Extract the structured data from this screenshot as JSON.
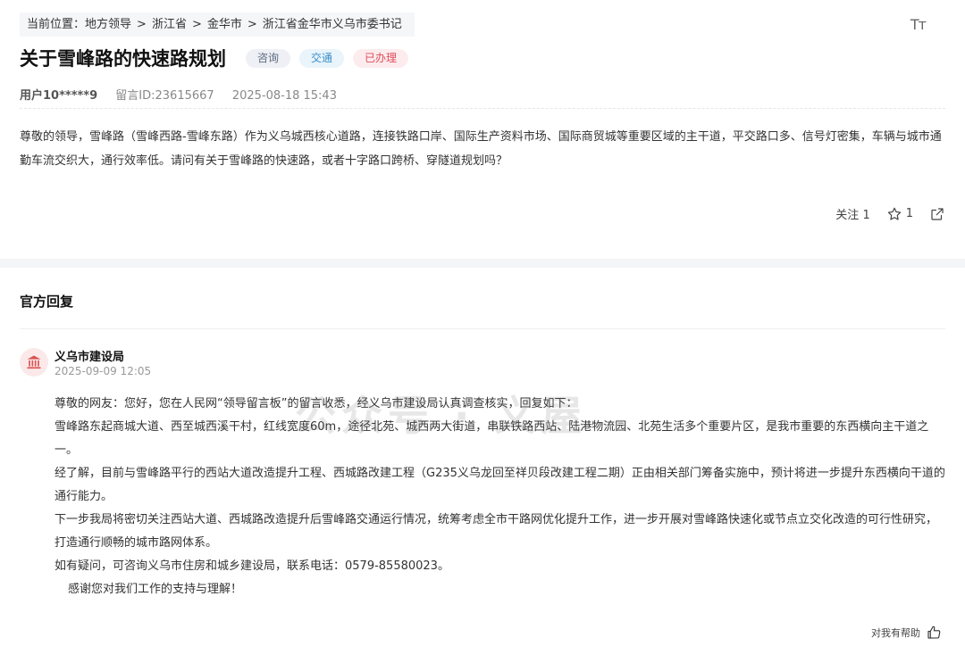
{
  "breadcrumb": {
    "prefix": "当前位置：",
    "items": [
      "地方领导",
      "浙江省",
      "金华市",
      "浙江省金华市义乌市委书记"
    ],
    "sep": ">"
  },
  "font_size_toggle": "Tт",
  "message": {
    "title": "关于雪峰路的快速路规划",
    "tags": {
      "category": "咨询",
      "field": "交通",
      "status": "已办理"
    },
    "user": "用户10*****9",
    "message_id": "留言ID:23615667",
    "datetime": "2025-08-18 15:43",
    "content": "尊敬的领导，雪峰路（雪峰西路-雪峰东路）作为义乌城西核心道路，连接铁路口岸、国际生产资料市场、国际商贸城等重要区域的主干道，平交路口多、信号灯密集，车辆与城市通勤车流交织大，通行效率低。请问有关于雪峰路的快速路，或者十字路口跨桥、穿隧道规划吗？"
  },
  "actions": {
    "follow_label": "关注",
    "follow_count": "1",
    "favorite_count": "1"
  },
  "reply": {
    "section_title": "官方回复",
    "org_name": "义乌市建设局",
    "datetime": "2025-09-09 12:05",
    "paragraphs": [
      "尊敬的网友：您好，您在人民网“领导留言板”的留言收悉，经义乌市建设局认真调查核实，回复如下：",
      "雪峰路东起商城大道、西至城西溪干村，红线宽度60m，途径北苑、城西两大街道，串联铁路西站、陆港物流园、北苑生活多个重要片区，是我市重要的东西横向主干道之一。",
      "经了解，目前与雪峰路平行的西站大道改造提升工程、西城路改建工程（G235义乌龙回至祥贝段改建工程二期）正由相关部门筹备实施中，预计将进一步提升东西横向干道的通行能力。",
      "下一步我局将密切关注西站大道、西城路改造提升后雪峰路交通运行情况，统筹考虑全市干路网优化提升工作，进一步开展对雪峰路快速化或节点立交化改造的可行性研究，打造通行顺畅的城市路网体系。",
      "如有疑问，可咨询义乌市住房和城乡建设局，联系电话：0579-85580023。",
      "感谢您对我们工作的支持与理解！"
    ],
    "helpful_label": "对我有帮助"
  },
  "watermark": "公众号 · 义屋",
  "colors": {
    "status_red": "#e04b5a",
    "field_blue": "#3a8fc7",
    "org_red": "#d9534f"
  }
}
